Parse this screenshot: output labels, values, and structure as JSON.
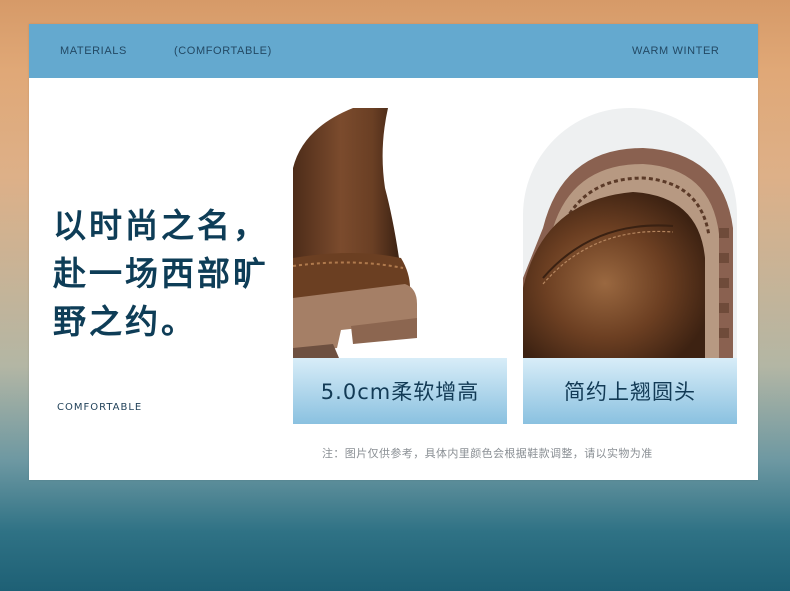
{
  "topbar": {
    "left_label": "MATERIALS",
    "middle_label": "(COMFORTABLE)",
    "right_label": "WARM WINTER",
    "color": "#64a9cf"
  },
  "headline": {
    "lines": [
      "以时尚之名，",
      "赴一场西部旷",
      "野之约。"
    ],
    "color": "#0e3d57"
  },
  "subtitle": "COMFORTABLE",
  "features": [
    {
      "caption": "5.0cm柔软增高",
      "icon": "boot-heel-photo"
    },
    {
      "caption": "简约上翘圆头",
      "icon": "boot-toe-photo"
    }
  ],
  "note": "注：图片仅供参考，具体内里颜色会根据鞋款调整，请以实物为准",
  "colors": {
    "leather": "#6e4226",
    "sole": "#a07c66",
    "caption_gradient_top": "#d8edf8",
    "caption_gradient_bottom": "#8ac1e0"
  }
}
